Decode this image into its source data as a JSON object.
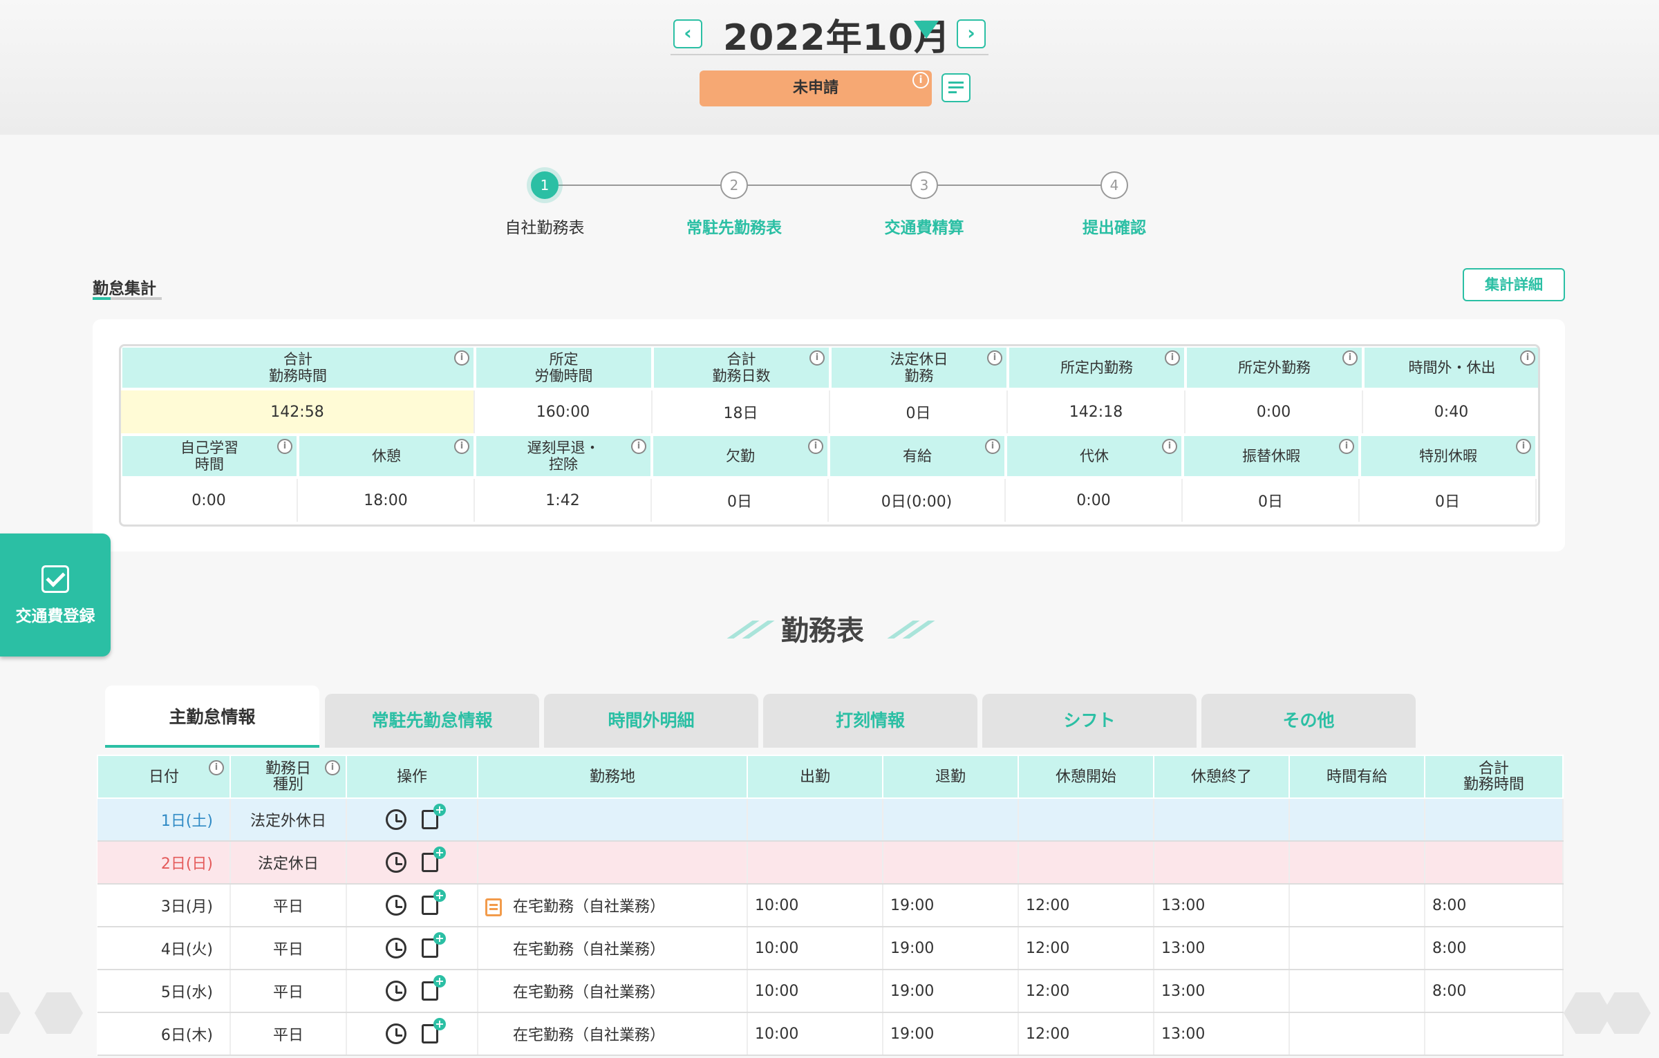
{
  "header": {
    "month_title": "2022年10月",
    "status": "未申請"
  },
  "steps": [
    {
      "num": "1",
      "label": "自社勤務表"
    },
    {
      "num": "2",
      "label": "常駐先勤務表"
    },
    {
      "num": "3",
      "label": "交通費精算"
    },
    {
      "num": "4",
      "label": "提出確認"
    }
  ],
  "summary": {
    "title": "勤怠集計",
    "detail_button": "集計詳細",
    "row1": [
      {
        "label": "合計\n勤務時間",
        "value": "142:58"
      },
      {
        "label": "所定\n労働時間",
        "value": "160:00"
      },
      {
        "label": "合計\n勤務日数",
        "value": "18日"
      },
      {
        "label": "法定休日\n勤務",
        "value": "0日"
      },
      {
        "label": "所定内勤務",
        "value": "142:18"
      },
      {
        "label": "所定外勤務",
        "value": "0:00"
      },
      {
        "label": "時間外・休出",
        "value": "0:40"
      }
    ],
    "row2": [
      {
        "label": "自己学習\n時間",
        "value": "0:00"
      },
      {
        "label": "休憩",
        "value": "18:00"
      },
      {
        "label": "遅刻早退・\n控除",
        "value": "1:42"
      },
      {
        "label": "欠勤",
        "value": "0日"
      },
      {
        "label": "有給",
        "value": "0日(0:00)"
      },
      {
        "label": "代休",
        "value": "0:00"
      },
      {
        "label": "振替休暇",
        "value": "0日"
      },
      {
        "label": "特別休暇",
        "value": "0日"
      }
    ]
  },
  "transport_button": "交通費登録",
  "section_title": "勤務表",
  "tabs": [
    "主勤怠情報",
    "常駐先勤怠情報",
    "時間外明細",
    "打刻情報",
    "シフト",
    "その他"
  ],
  "table": {
    "headers": [
      "日付",
      "勤務日\n種別",
      "操作",
      "勤務地",
      "出勤",
      "退勤",
      "休憩開始",
      "休憩終了",
      "時間有給",
      "合計\n勤務時間"
    ],
    "rows": [
      {
        "date": "1日(土)",
        "type": "法定外休日",
        "place": "",
        "in": "",
        "out": "",
        "bs": "",
        "be": "",
        "paid": "",
        "total": ""
      },
      {
        "date": "2日(日)",
        "type": "法定休日",
        "place": "",
        "in": "",
        "out": "",
        "bs": "",
        "be": "",
        "paid": "",
        "total": ""
      },
      {
        "date": "3日(月)",
        "type": "平日",
        "place": "在宅勤務（自社業務）",
        "in": "10:00",
        "out": "19:00",
        "bs": "12:00",
        "be": "13:00",
        "paid": "",
        "total": "8:00"
      },
      {
        "date": "4日(火)",
        "type": "平日",
        "place": "在宅勤務（自社業務）",
        "in": "10:00",
        "out": "19:00",
        "bs": "12:00",
        "be": "13:00",
        "paid": "",
        "total": "8:00"
      },
      {
        "date": "5日(水)",
        "type": "平日",
        "place": "在宅勤務（自社業務）",
        "in": "10:00",
        "out": "19:00",
        "bs": "12:00",
        "be": "13:00",
        "paid": "",
        "total": "8:00"
      },
      {
        "date": "6日(木)",
        "type": "平日",
        "place": "在宅勤務（自社業務）",
        "in": "10:00",
        "out": "19:00",
        "bs": "12:00",
        "be": "13:00",
        "paid": "",
        "total": ""
      }
    ]
  },
  "colors": {
    "accent": "#2bbfa4",
    "status_pill": "#f6a873",
    "header_cell": "#c8f4ee",
    "highlight_cell": "#fffbd6",
    "saturday_row": "#e1f2fb",
    "sunday_row": "#fce6ea"
  }
}
